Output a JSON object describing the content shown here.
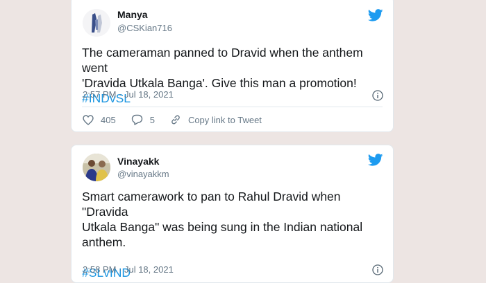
{
  "tweets": [
    {
      "name": "Manya",
      "handle": "@CSKian716",
      "text_line1": "The cameraman panned to Dravid when the anthem went",
      "text_line2": "'Dravida Utkala Banga'. Give this man a promotion!",
      "hashtag": "#INDvSL",
      "timestamp": "2:57 PM · Jul 18, 2021",
      "likes": "405",
      "replies": "5",
      "copy_link_label": "Copy link to Tweet"
    },
    {
      "name": "Vinayakk",
      "handle": "@vinayakkm",
      "text_line1": "Smart camerawork to pan to Rahul Dravid when \"Dravida",
      "text_line2": "Utkala Banga\" was being sung in the Indian national",
      "text_line3": "anthem.",
      "hashtag": "#SLvIND",
      "timestamp": "2:58 PM · Jul 18, 2021"
    }
  ],
  "colors": {
    "background": "#ede5e3",
    "twitter_blue": "#1d9bf0",
    "hashtag": "#1b95e0",
    "muted": "#657786"
  },
  "icons": [
    "twitter-bird-icon",
    "info-icon",
    "heart-icon",
    "reply-icon",
    "link-icon"
  ]
}
